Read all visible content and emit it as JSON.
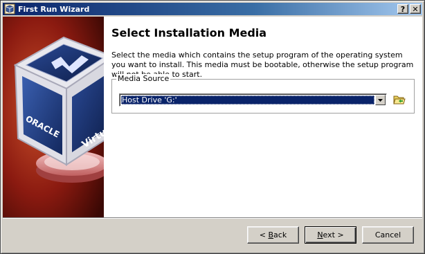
{
  "window": {
    "title": "First Run Wizard",
    "help_button": "?",
    "close_button": "✕"
  },
  "page": {
    "heading": "Select Installation Media",
    "description": "Select the media which contains the setup program of the operating system you want to install. This media must be bootable, otherwise the setup program will not be able to start."
  },
  "media_source": {
    "label": "Media Source",
    "selected_value": "Host Drive 'G:'"
  },
  "buttons": {
    "back": {
      "prefix": "< ",
      "mnemonic": "B",
      "rest": "ack"
    },
    "next": {
      "mnemonic": "N",
      "rest": "ext >"
    },
    "cancel": "Cancel"
  },
  "side_image": {
    "brand_top": "ORACLE",
    "brand_side": "Virtu"
  },
  "colors": {
    "titlebar_start": "#0a246a",
    "titlebar_end": "#a6caf0",
    "selection": "#0a246a",
    "side_background": "#8b1a10"
  },
  "icons": {
    "app": "virtualbox-icon",
    "dropdown": "chevron-down-icon",
    "browse": "folder-open-icon"
  }
}
